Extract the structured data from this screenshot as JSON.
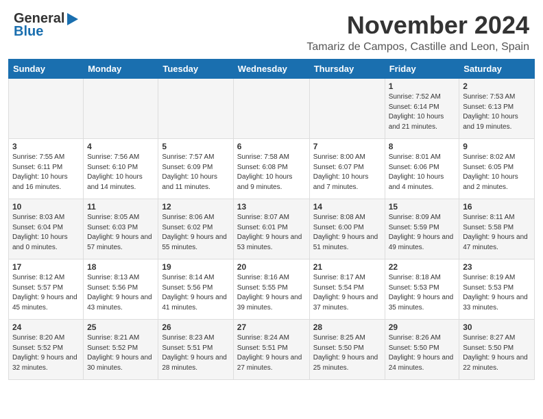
{
  "logo": {
    "line1": "General",
    "line2": "Blue"
  },
  "header": {
    "month": "November 2024",
    "location": "Tamariz de Campos, Castille and Leon, Spain"
  },
  "weekdays": [
    "Sunday",
    "Monday",
    "Tuesday",
    "Wednesday",
    "Thursday",
    "Friday",
    "Saturday"
  ],
  "weeks": [
    [
      {
        "day": "",
        "info": ""
      },
      {
        "day": "",
        "info": ""
      },
      {
        "day": "",
        "info": ""
      },
      {
        "day": "",
        "info": ""
      },
      {
        "day": "",
        "info": ""
      },
      {
        "day": "1",
        "info": "Sunrise: 7:52 AM\nSunset: 6:14 PM\nDaylight: 10 hours and 21 minutes."
      },
      {
        "day": "2",
        "info": "Sunrise: 7:53 AM\nSunset: 6:13 PM\nDaylight: 10 hours and 19 minutes."
      }
    ],
    [
      {
        "day": "3",
        "info": "Sunrise: 7:55 AM\nSunset: 6:11 PM\nDaylight: 10 hours and 16 minutes."
      },
      {
        "day": "4",
        "info": "Sunrise: 7:56 AM\nSunset: 6:10 PM\nDaylight: 10 hours and 14 minutes."
      },
      {
        "day": "5",
        "info": "Sunrise: 7:57 AM\nSunset: 6:09 PM\nDaylight: 10 hours and 11 minutes."
      },
      {
        "day": "6",
        "info": "Sunrise: 7:58 AM\nSunset: 6:08 PM\nDaylight: 10 hours and 9 minutes."
      },
      {
        "day": "7",
        "info": "Sunrise: 8:00 AM\nSunset: 6:07 PM\nDaylight: 10 hours and 7 minutes."
      },
      {
        "day": "8",
        "info": "Sunrise: 8:01 AM\nSunset: 6:06 PM\nDaylight: 10 hours and 4 minutes."
      },
      {
        "day": "9",
        "info": "Sunrise: 8:02 AM\nSunset: 6:05 PM\nDaylight: 10 hours and 2 minutes."
      }
    ],
    [
      {
        "day": "10",
        "info": "Sunrise: 8:03 AM\nSunset: 6:04 PM\nDaylight: 10 hours and 0 minutes."
      },
      {
        "day": "11",
        "info": "Sunrise: 8:05 AM\nSunset: 6:03 PM\nDaylight: 9 hours and 57 minutes."
      },
      {
        "day": "12",
        "info": "Sunrise: 8:06 AM\nSunset: 6:02 PM\nDaylight: 9 hours and 55 minutes."
      },
      {
        "day": "13",
        "info": "Sunrise: 8:07 AM\nSunset: 6:01 PM\nDaylight: 9 hours and 53 minutes."
      },
      {
        "day": "14",
        "info": "Sunrise: 8:08 AM\nSunset: 6:00 PM\nDaylight: 9 hours and 51 minutes."
      },
      {
        "day": "15",
        "info": "Sunrise: 8:09 AM\nSunset: 5:59 PM\nDaylight: 9 hours and 49 minutes."
      },
      {
        "day": "16",
        "info": "Sunrise: 8:11 AM\nSunset: 5:58 PM\nDaylight: 9 hours and 47 minutes."
      }
    ],
    [
      {
        "day": "17",
        "info": "Sunrise: 8:12 AM\nSunset: 5:57 PM\nDaylight: 9 hours and 45 minutes."
      },
      {
        "day": "18",
        "info": "Sunrise: 8:13 AM\nSunset: 5:56 PM\nDaylight: 9 hours and 43 minutes."
      },
      {
        "day": "19",
        "info": "Sunrise: 8:14 AM\nSunset: 5:56 PM\nDaylight: 9 hours and 41 minutes."
      },
      {
        "day": "20",
        "info": "Sunrise: 8:16 AM\nSunset: 5:55 PM\nDaylight: 9 hours and 39 minutes."
      },
      {
        "day": "21",
        "info": "Sunrise: 8:17 AM\nSunset: 5:54 PM\nDaylight: 9 hours and 37 minutes."
      },
      {
        "day": "22",
        "info": "Sunrise: 8:18 AM\nSunset: 5:53 PM\nDaylight: 9 hours and 35 minutes."
      },
      {
        "day": "23",
        "info": "Sunrise: 8:19 AM\nSunset: 5:53 PM\nDaylight: 9 hours and 33 minutes."
      }
    ],
    [
      {
        "day": "24",
        "info": "Sunrise: 8:20 AM\nSunset: 5:52 PM\nDaylight: 9 hours and 32 minutes."
      },
      {
        "day": "25",
        "info": "Sunrise: 8:21 AM\nSunset: 5:52 PM\nDaylight: 9 hours and 30 minutes."
      },
      {
        "day": "26",
        "info": "Sunrise: 8:23 AM\nSunset: 5:51 PM\nDaylight: 9 hours and 28 minutes."
      },
      {
        "day": "27",
        "info": "Sunrise: 8:24 AM\nSunset: 5:51 PM\nDaylight: 9 hours and 27 minutes."
      },
      {
        "day": "28",
        "info": "Sunrise: 8:25 AM\nSunset: 5:50 PM\nDaylight: 9 hours and 25 minutes."
      },
      {
        "day": "29",
        "info": "Sunrise: 8:26 AM\nSunset: 5:50 PM\nDaylight: 9 hours and 24 minutes."
      },
      {
        "day": "30",
        "info": "Sunrise: 8:27 AM\nSunset: 5:50 PM\nDaylight: 9 hours and 22 minutes."
      }
    ]
  ]
}
